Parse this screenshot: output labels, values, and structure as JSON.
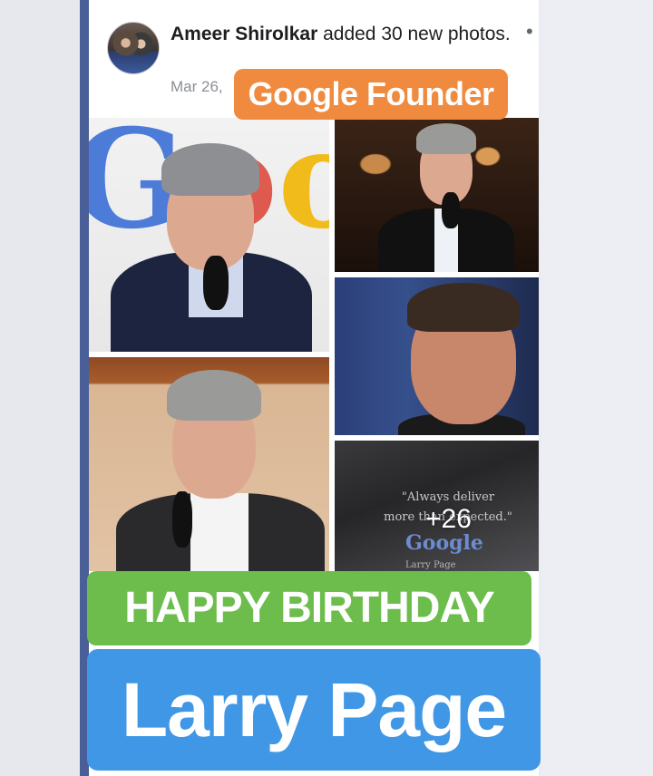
{
  "post": {
    "author": "Ameer Shirolkar",
    "action": " added 30 new photos.",
    "date": "Mar 26,",
    "more_icon": "more-dots-icon",
    "more_glyph": "•"
  },
  "photos": {
    "p1_logo": "Goog",
    "more_count": "+26",
    "quote": {
      "line1": "\"Always deliver",
      "line2": "more than expected.\"",
      "brand": "Google",
      "author": "Larry Page"
    }
  },
  "overlays": {
    "founder_tag": "Google Founder",
    "birthday": "HAPPY BIRTHDAY",
    "name": "Larry Page"
  },
  "colors": {
    "founder_tag": "#f08a3e",
    "birthday": "#6cbd4c",
    "name": "#3f97e6",
    "sidebar_accent": "#4a5f98"
  }
}
